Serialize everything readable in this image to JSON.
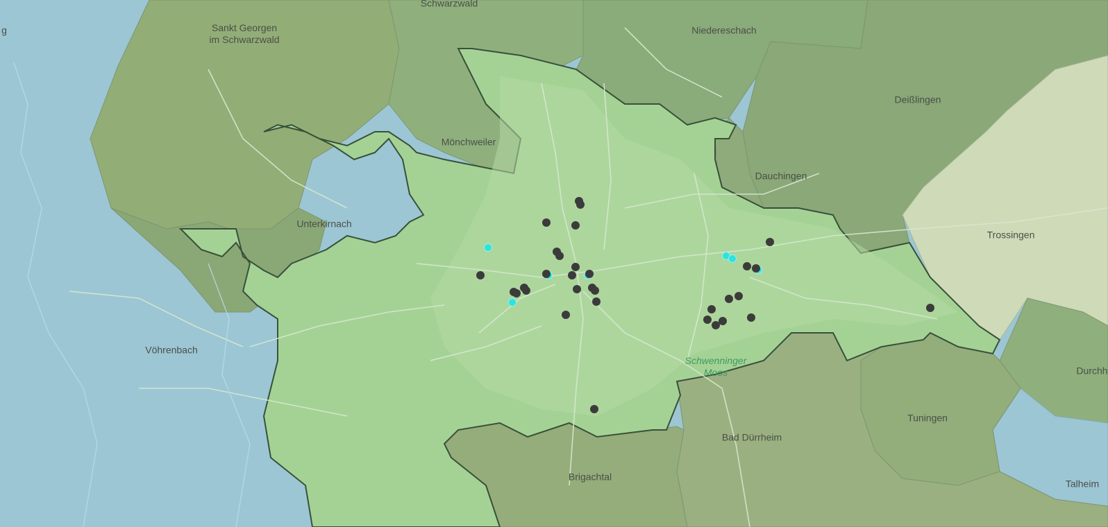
{
  "map": {
    "place_labels": [
      {
        "id": "schwarzwald",
        "text": "Schwarzwald"
      },
      {
        "id": "sankt-georgen",
        "text": "Sankt Georgen\nim Schwarzwald"
      },
      {
        "id": "niedereschach",
        "text": "Niedereschach"
      },
      {
        "id": "deisslingen",
        "text": "Deißlingen"
      },
      {
        "id": "moenchweiler",
        "text": "Mönchweiler"
      },
      {
        "id": "dauchingen",
        "text": "Dauchingen"
      },
      {
        "id": "unterkirnach",
        "text": "Unterkirnach"
      },
      {
        "id": "trossingen",
        "text": "Trossingen"
      },
      {
        "id": "voehrenbach",
        "text": "Vöhrenbach"
      },
      {
        "id": "schwenninger-moos",
        "text": "Schwenninger\nMoos"
      },
      {
        "id": "durchhausen",
        "text": "Durchh"
      },
      {
        "id": "tuningen",
        "text": "Tuningen"
      },
      {
        "id": "bad-duerrheim",
        "text": "Bad Dürrheim"
      },
      {
        "id": "brigachtal",
        "text": "Brigachtal"
      },
      {
        "id": "talheim",
        "text": "Talheim"
      },
      {
        "id": "edge-g",
        "text": "g"
      }
    ],
    "marker_styles": {
      "dark": {
        "color": "#3b3b3b",
        "label": ""
      },
      "cyan": {
        "color": "#34e0dc",
        "label": ""
      }
    },
    "region_colors": {
      "highlight": "#a4d295",
      "dark_green": "#8fb07d",
      "olive": "#93ad76",
      "pale": "#cfdab8",
      "blue": "#9cc6d4",
      "border": "#38503a"
    }
  }
}
